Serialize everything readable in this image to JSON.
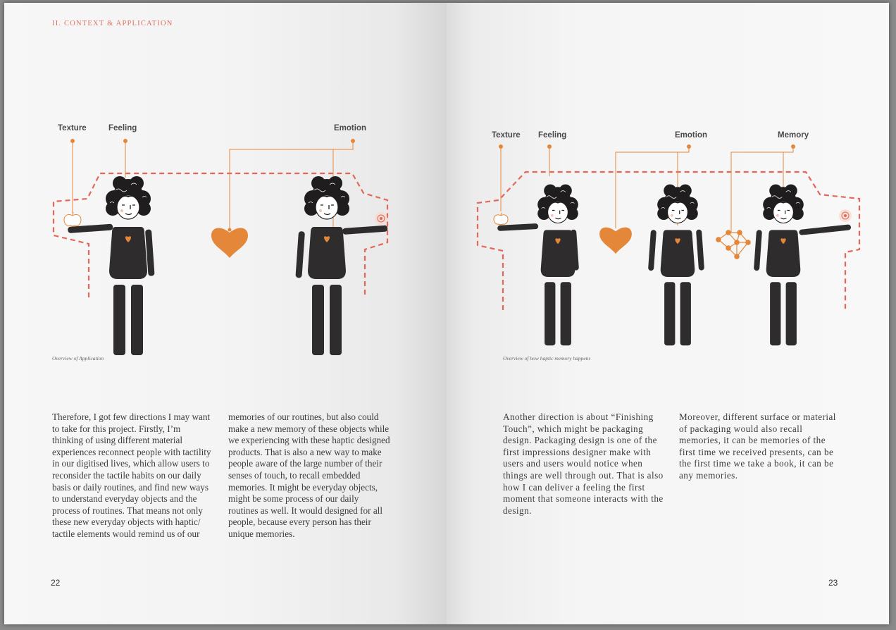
{
  "left_page": {
    "running_head": "II. CONTEXT & APPLICATION",
    "labels": {
      "texture": "Texture",
      "feeling": "Feeling",
      "emotion": "Emotion"
    },
    "caption": "Overview of  Application",
    "columns": [
      "Therefore, I got few directions I may want to take for this project. Firstly, I’m thinking of using different material experiences reconnect people with tactility in our digitised lives, which allow users to reconsider the tactile habits on our daily basis or daily routines, and find new ways to understand everyday objects and the process of routines. That means not only these new everyday objects with haptic/ tactile elements would remind us of our",
      "memories of our routines, but also could make a new memory of these objects while we experiencing with these haptic designed products. That is also a new way to make people aware of the large number of their senses of touch, to recall embedded memories. It might be everyday objects, might be some process of our daily routines as well. It would designed for all people, because every person has their unique memories."
    ],
    "page_number": "22"
  },
  "right_page": {
    "labels": {
      "texture": "Texture",
      "feeling": "Feeling",
      "emotion": "Emotion",
      "memory": "Memory"
    },
    "caption": "Overview of  how haptic memory happens",
    "columns": [
      "Another direction is about “Finishing Touch”, which might be packaging design. Packaging design is one of the first impressions designer make with users and users would notice when things are well through out. That is also how I can deliver a feeling the first moment that someone interacts with the design.",
      "Moreover, different surface or material of packaging would also recall memories, it can be memories of the first time we received presents, can be the first time we take a book, it can be any memories."
    ],
    "page_number": "23"
  },
  "colors": {
    "accent_orange": "#e58739",
    "dashed_red": "#e4685a",
    "figure_dark": "#2e2c2c",
    "heading_red": "#e0705f"
  }
}
